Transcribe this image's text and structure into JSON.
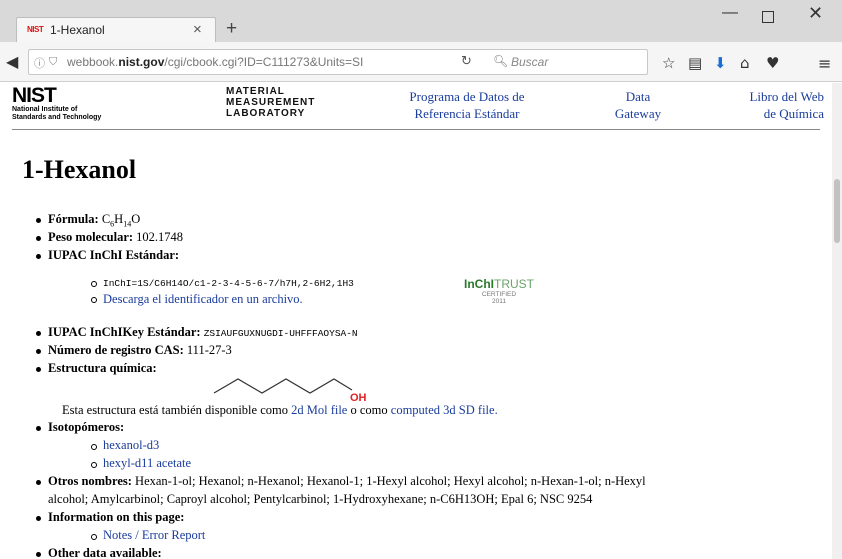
{
  "browser": {
    "tab_favicon": "NIST",
    "tab_title": "1-Hexanol",
    "tab_close": "×",
    "new_tab": "+",
    "url_prefix": "webbook.",
    "url_domain": "nist.gov",
    "url_path": "/cgi/cbook.cgi?ID=C111273&Units=SI",
    "search_placeholder": "Buscar",
    "icons": [
      "back-arrow-icon",
      "info-icon",
      "tracking-shield-icon",
      "reload-icon",
      "search-icon",
      "bookmark-star-icon",
      "reading-list-icon",
      "download-icon",
      "home-icon",
      "pocket-icon",
      "menu-icon"
    ]
  },
  "header": {
    "logo_big": "NIST",
    "logo_line1": "National Institute of",
    "logo_line2": "Standards and Technology",
    "mml_line1": "MATERIAL",
    "mml_line2": "MEASUREMENT",
    "mml_line3": "LABORATORY",
    "link_srd_1": "Programa de Datos de",
    "link_srd_2": "Referencia Estándar",
    "link_gateway_1": "Data",
    "link_gateway_2": "Gateway",
    "link_webbook_1": "Libro del Web",
    "link_webbook_2": "de Química"
  },
  "content": {
    "title": "1-Hexanol",
    "formula_label": "Fórmula:",
    "formula_c": "C",
    "formula_c_n": "6",
    "formula_h": "H",
    "formula_h_n": "14",
    "formula_o": "O",
    "mw_label": "Peso molecular:",
    "mw_value": "102.1748",
    "inchi_label": "IUPAC InChI Estándar:",
    "inchi_value": "InChI=1S/C6H14O/c1-2-3-4-5-6-7/h7H,2-6H2,1H3",
    "inchi_download": "Descarga el identificador en un archivo.",
    "inchi_trust_a": "InChI",
    "inchi_trust_b": "TRUST",
    "inchi_trust_c": "CERTIFIED",
    "inchi_trust_d": "2011",
    "inchikey_label": "IUPAC InChIKey Estándar:",
    "inchikey_value": "ZSIAUFGUXNUGDI-UHFFFAOYSA-N",
    "cas_label": "Número de registro CAS:",
    "cas_value": "111-27-3",
    "structure_label": "Estructura química:",
    "structure_oh": "OH",
    "also_text_1": "Esta estructura está también disponible como ",
    "also_link_1": "2d Mol file",
    "also_text_2": " o como ",
    "also_link_2": "computed 3d SD file.",
    "isotopologues_label": "Isotopómeros:",
    "isotopologue_1": "hexanol-d3",
    "isotopologue_2": "hexyl-d11 acetate",
    "other_names_label": "Otros nombres:",
    "other_names_line1": "Hexan-1-ol; Hexanol; n-Hexanol; Hexanol-1; 1-Hexyl alcohol; Hexyl alcohol; n-Hexan-1-ol; n-Hexyl",
    "other_names_line2": "alcohol; Amylcarbinol; Caproyl alcohol; Pentylcarbinol; 1-Hydroxyhexane; n-C6H13OH; Epal 6; NSC 9254",
    "info_label": "Information on this page:",
    "info_notes": "Notes / Error Report",
    "other_data_label": "Other data available:"
  },
  "colors": {
    "link": "#1a3c9c",
    "inchi_green": "#2a7a2a",
    "oh_red": "#e02020"
  }
}
